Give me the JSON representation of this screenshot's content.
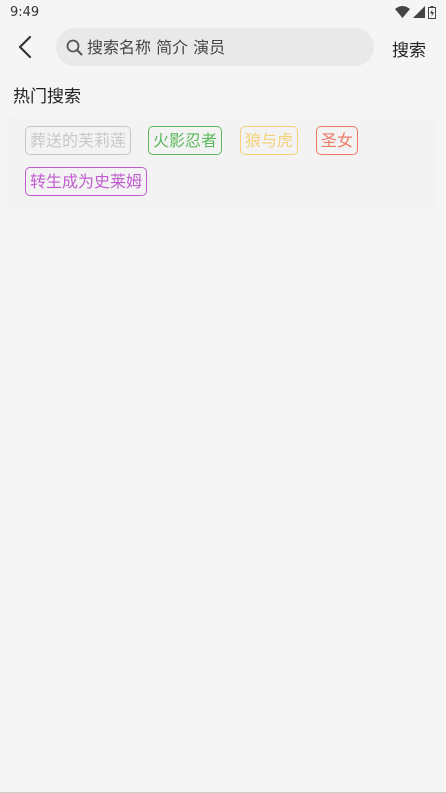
{
  "status_bar": {
    "time": "9:49",
    "icons": [
      "wifi-icon",
      "signal-icon",
      "battery-icon"
    ]
  },
  "header": {
    "back_icon": "chevron-left-icon",
    "search_icon": "search-icon",
    "search_placeholder": "搜索名称 简介 演员",
    "search_value": "",
    "search_button": "搜索"
  },
  "hot": {
    "title": "热门搜索",
    "tags": [
      {
        "label": "葬送的芙莉莲",
        "color": "#c8c8c8"
      },
      {
        "label": "火影忍者",
        "color": "#5cb85c"
      },
      {
        "label": "狼与虎",
        "color": "#f5d27a"
      },
      {
        "label": "圣女",
        "color": "#ec7b66"
      },
      {
        "label": "转生成为史莱姆",
        "color": "#c05ccf"
      }
    ]
  }
}
